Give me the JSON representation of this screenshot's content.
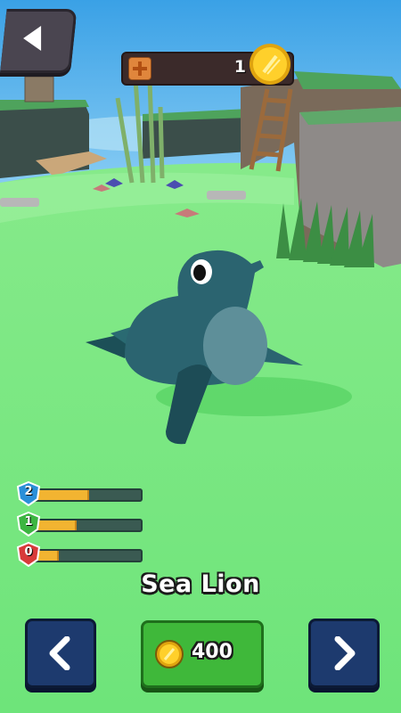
{
  "coins": {
    "count": "1"
  },
  "stats": [
    {
      "level": "2",
      "fill": 0.5,
      "color": "#2a8fd8"
    },
    {
      "level": "1",
      "fill": 0.38,
      "color": "#3cb541"
    },
    {
      "level": "0",
      "fill": 0.22,
      "color": "#d83a3a"
    }
  ],
  "animal": {
    "name": "Sea Lion"
  },
  "buy": {
    "price": "400"
  },
  "icons": {
    "back": "arrow-left-icon",
    "prev": "chevron-left-icon",
    "next": "chevron-right-icon",
    "coin": "coin-icon",
    "plus": "plus-icon"
  }
}
